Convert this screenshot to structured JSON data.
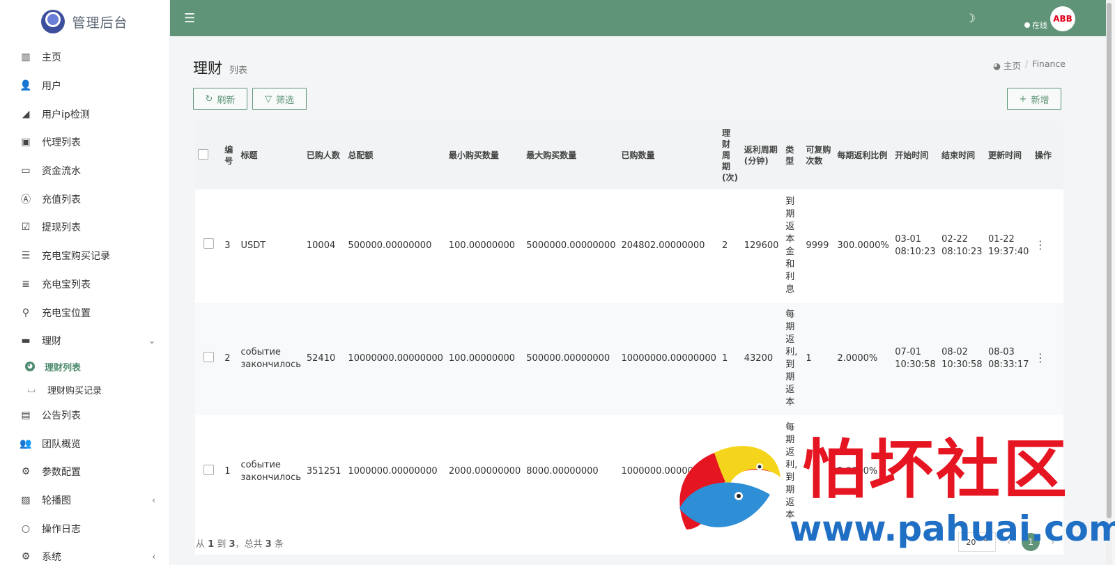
{
  "app": {
    "title": "管理后台"
  },
  "sidebar": {
    "items": [
      {
        "label": "主页",
        "icon": "bar-chart-icon"
      },
      {
        "label": "用户",
        "icon": "user-icon"
      },
      {
        "label": "用户ip检测",
        "icon": "area-chart-icon"
      },
      {
        "label": "代理列表",
        "icon": "contact-card-icon"
      },
      {
        "label": "资金流水",
        "icon": "money-bill-icon"
      },
      {
        "label": "充值列表",
        "icon": "a-box-icon"
      },
      {
        "label": "提现列表",
        "icon": "checkbox-checked-icon"
      },
      {
        "label": "充电宝购买记录",
        "icon": "list-icon"
      },
      {
        "label": "充电宝列表",
        "icon": "indent-list-icon"
      },
      {
        "label": "充电宝位置",
        "icon": "map-pin-icon"
      },
      {
        "label": "理财",
        "icon": "archive-icon"
      }
    ],
    "sub_items": [
      {
        "label": "理财列表",
        "icon": "dashboard-icon"
      },
      {
        "label": "理财购买记录",
        "icon": "bath-icon"
      }
    ],
    "items_after": [
      {
        "label": "公告列表",
        "icon": "file-text-icon"
      },
      {
        "label": "团队概览",
        "icon": "users-icon"
      },
      {
        "label": "参数配置",
        "icon": "cogs-icon"
      },
      {
        "label": "轮播图",
        "icon": "image-icon"
      },
      {
        "label": "操作日志",
        "icon": "circle-icon"
      },
      {
        "label": "系统",
        "icon": "gear-icon"
      }
    ]
  },
  "topbar": {
    "status": "在线",
    "avatar": "ABB"
  },
  "page": {
    "title": "理财",
    "subtitle": "列表"
  },
  "breadcrumb": {
    "home": "主页",
    "current": "Finance"
  },
  "toolbar": {
    "refresh": "刷新",
    "filter": "筛选",
    "add": "新增"
  },
  "table": {
    "headers": [
      "编号",
      "标题",
      "已购人数",
      "总配额",
      "最小购买数量",
      "最大购买数量",
      "已购数量",
      "理财周期(次)",
      "返利周期(分钟)",
      "类型",
      "可复购次数",
      "每期返利比例",
      "开始时间",
      "结束时间",
      "更新时间",
      "操作"
    ],
    "rows": [
      {
        "id": "3",
        "title": "USDT",
        "buyers": "10004",
        "quota": "500000.00000000",
        "min": "100.00000000",
        "max": "5000000.00000000",
        "bought": "204802.00000000",
        "cycles": "2",
        "period": "129600",
        "type": "到期返本金和利息",
        "repeat": "9999",
        "rate": "300.0000%",
        "start": "03-01 08:10:23",
        "end": "02-22 08:10:23",
        "updated": "01-22 19:37:40"
      },
      {
        "id": "2",
        "title": "событие закончилось",
        "buyers": "52410",
        "quota": "10000000.00000000",
        "min": "100.00000000",
        "max": "500000.00000000",
        "bought": "10000000.00000000",
        "cycles": "1",
        "period": "43200",
        "type": "每期返利,到期返本",
        "repeat": "1",
        "rate": "2.0000%",
        "start": "07-01 10:30:58",
        "end": "08-02 10:30:58",
        "updated": "08-03 08:33:17"
      },
      {
        "id": "1",
        "title": "событие закончилось",
        "buyers": "351251",
        "quota": "1000000.00000000",
        "min": "2000.00000000",
        "max": "8000.00000000",
        "bought": "1000000.00000000",
        "cycles": "",
        "period": "",
        "type": "每期返利,到期返本",
        "repeat": "",
        "rate": "2.0000%",
        "start": "",
        "end": "",
        "updated": ""
      }
    ]
  },
  "footer": {
    "prefix": "从",
    "from": "1",
    "mid": "到",
    "to": "3",
    "total_prefix": "，总共",
    "total": "3",
    "suffix": "条"
  },
  "pagination": {
    "page_size": "20",
    "current": "1"
  },
  "watermark": {
    "text": "怕坏社区",
    "url": "www.pahuai.com"
  },
  "colors": {
    "primary": "#5f9478",
    "watermark_red": "#e61522",
    "watermark_blue": "#1f6fc4"
  }
}
